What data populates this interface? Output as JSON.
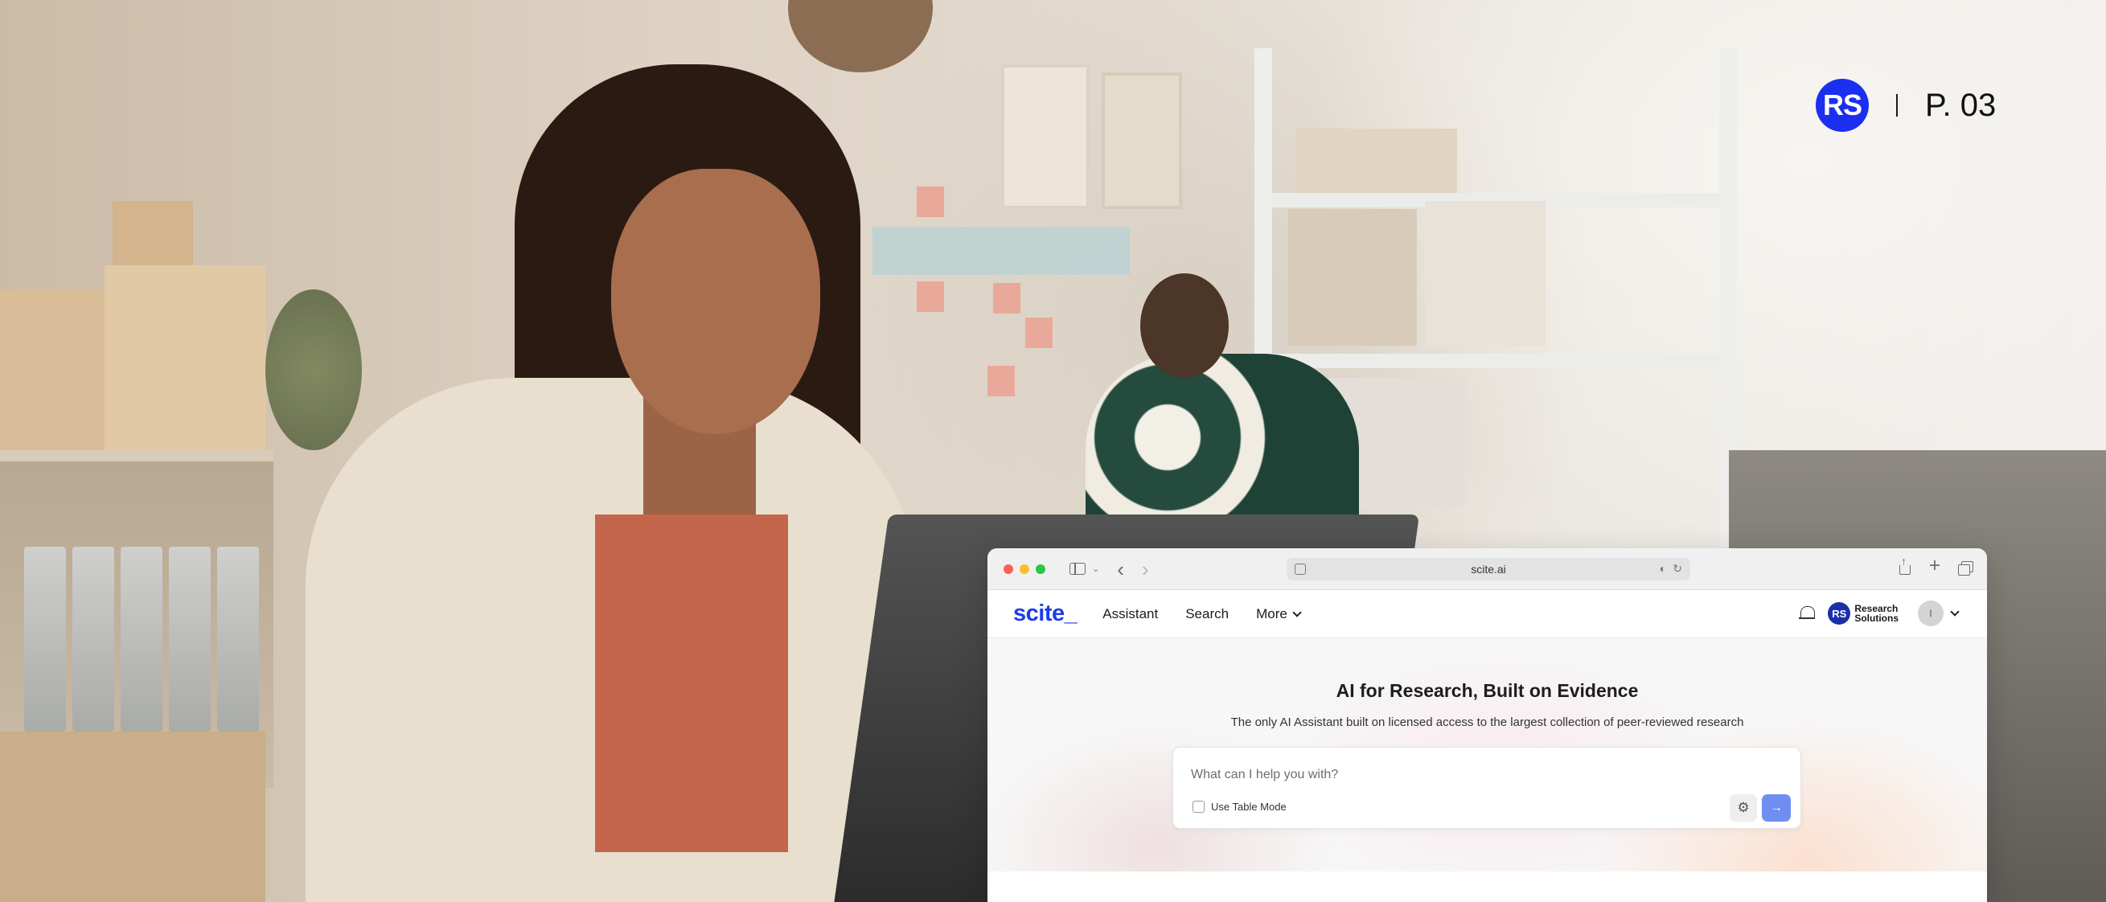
{
  "branding": {
    "badge": "RS",
    "page_label": "P. 03"
  },
  "browser": {
    "url": "scite.ai"
  },
  "site_nav": {
    "logo": "scite_",
    "links": [
      "Assistant",
      "Search",
      "More"
    ],
    "partner_badge": "RS",
    "partner_name_line1": "Research",
    "partner_name_line2": "Solutions",
    "avatar_initial": "I"
  },
  "hero": {
    "title": "AI for Research, Built on Evidence",
    "subtitle": "The only AI Assistant built on licensed access to the largest collection of peer-reviewed research",
    "input_placeholder": "What can I help you with?",
    "table_mode_label": "Use Table Mode"
  },
  "icons": {
    "settings": "gear-icon",
    "send": "arrow-right-icon",
    "notifications": "bell-icon"
  },
  "colors": {
    "brand_blue": "#1e3de4",
    "badge_blue": "#1b2ff0",
    "send_button": "#6f8ef1"
  }
}
